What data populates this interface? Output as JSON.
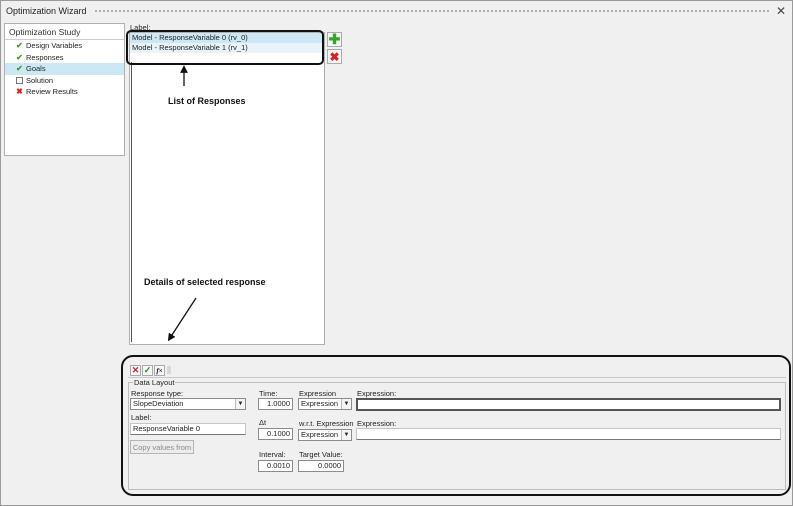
{
  "window": {
    "title": "Optimization Wizard",
    "close_icon": "close-icon"
  },
  "tree": {
    "header": "Optimization Study",
    "items": [
      {
        "label": "Design Variables",
        "status": "check"
      },
      {
        "label": "Responses",
        "status": "check"
      },
      {
        "label": "Goals",
        "status": "check",
        "selected": true
      },
      {
        "label": "Solution",
        "status": "empty"
      },
      {
        "label": "Review Results",
        "status": "cross"
      }
    ]
  },
  "responses": {
    "label": "Label:",
    "items": [
      "Model - ResponseVariable 0 (rv_0)",
      "Model - ResponseVariable 1 (rv_1)"
    ],
    "add_icon": "plus-icon",
    "delete_icon": "delete-x-icon"
  },
  "annotations": {
    "list": "List of Responses",
    "details": "Details of selected response"
  },
  "toolbar": {
    "fx_label": "f×"
  },
  "details": {
    "group_title": "Data Layout",
    "response_type_label": "Response type:",
    "response_type_value": "SlopeDeviation",
    "label_label": "Label:",
    "label_value": "ResponseVariable 0",
    "copy_button": "Copy values from",
    "time_label": "Time:",
    "time_value": "1.0000",
    "dt_label": "Δt",
    "dt_value": "0.1000",
    "interval_label": "Interval:",
    "interval_value": "0.0010",
    "expression_type_label": "Expression",
    "expression_type_value": "Expression",
    "expression_label": "Expression:",
    "expression_value": "",
    "wrt_label": "w.r.t. Expression",
    "wrt_type_value": "Expression",
    "wrt_expression_label": "Expression:",
    "wrt_expression_value": "",
    "target_label": "Target Value:",
    "target_value": "0.0000"
  }
}
